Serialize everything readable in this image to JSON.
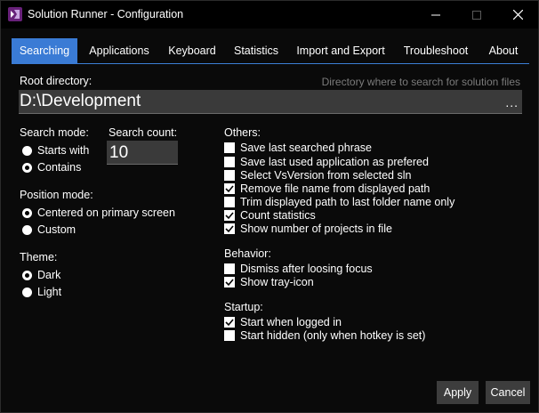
{
  "window": {
    "title": "Solution Runner - Configuration"
  },
  "tabs": [
    {
      "label": "Searching",
      "active": true
    },
    {
      "label": "Applications"
    },
    {
      "label": "Keyboard"
    },
    {
      "label": "Statistics"
    },
    {
      "label": "Import and Export"
    },
    {
      "label": "Troubleshoot"
    },
    {
      "label": "About"
    }
  ],
  "searching": {
    "root_label": "Root directory:",
    "root_hint": "Directory where to search for solution files",
    "root_value": "D:\\Development",
    "root_browse": "...",
    "search_mode_label": "Search mode:",
    "search_modes": [
      {
        "label": "Starts with",
        "checked": false
      },
      {
        "label": "Contains",
        "checked": true
      }
    ],
    "search_count_label": "Search count:",
    "search_count_value": "10",
    "position_mode_label": "Position mode:",
    "position_modes": [
      {
        "label": "Centered on primary screen",
        "checked": true
      },
      {
        "label": "Custom",
        "checked": false
      }
    ],
    "theme_label": "Theme:",
    "themes": [
      {
        "label": "Dark",
        "checked": true
      },
      {
        "label": "Light",
        "checked": false
      }
    ],
    "others_label": "Others:",
    "others": [
      {
        "label": "Save last searched phrase",
        "checked": false
      },
      {
        "label": "Save last used application as prefered",
        "checked": false
      },
      {
        "label": "Select VsVersion from selected sln",
        "checked": false
      },
      {
        "label": "Remove file name from displayed path",
        "checked": true
      },
      {
        "label": "Trim displayed path to last folder name only",
        "checked": false
      },
      {
        "label": "Count statistics",
        "checked": true
      },
      {
        "label": "Show number of projects in file",
        "checked": true
      }
    ],
    "behavior_label": "Behavior:",
    "behavior": [
      {
        "label": "Dismiss after loosing focus",
        "checked": false
      },
      {
        "label": "Show tray-icon",
        "checked": true
      }
    ],
    "startup_label": "Startup:",
    "startup": [
      {
        "label": "Start when logged in",
        "checked": true
      },
      {
        "label": "Start hidden (only when hotkey is set)",
        "checked": false
      }
    ]
  },
  "buttons": {
    "apply": "Apply",
    "cancel": "Cancel"
  },
  "colors": {
    "accent": "#3a7bd5",
    "background": "#0a0a0a",
    "input_bg": "#3a3a3a",
    "hint": "#7b7b7b"
  }
}
